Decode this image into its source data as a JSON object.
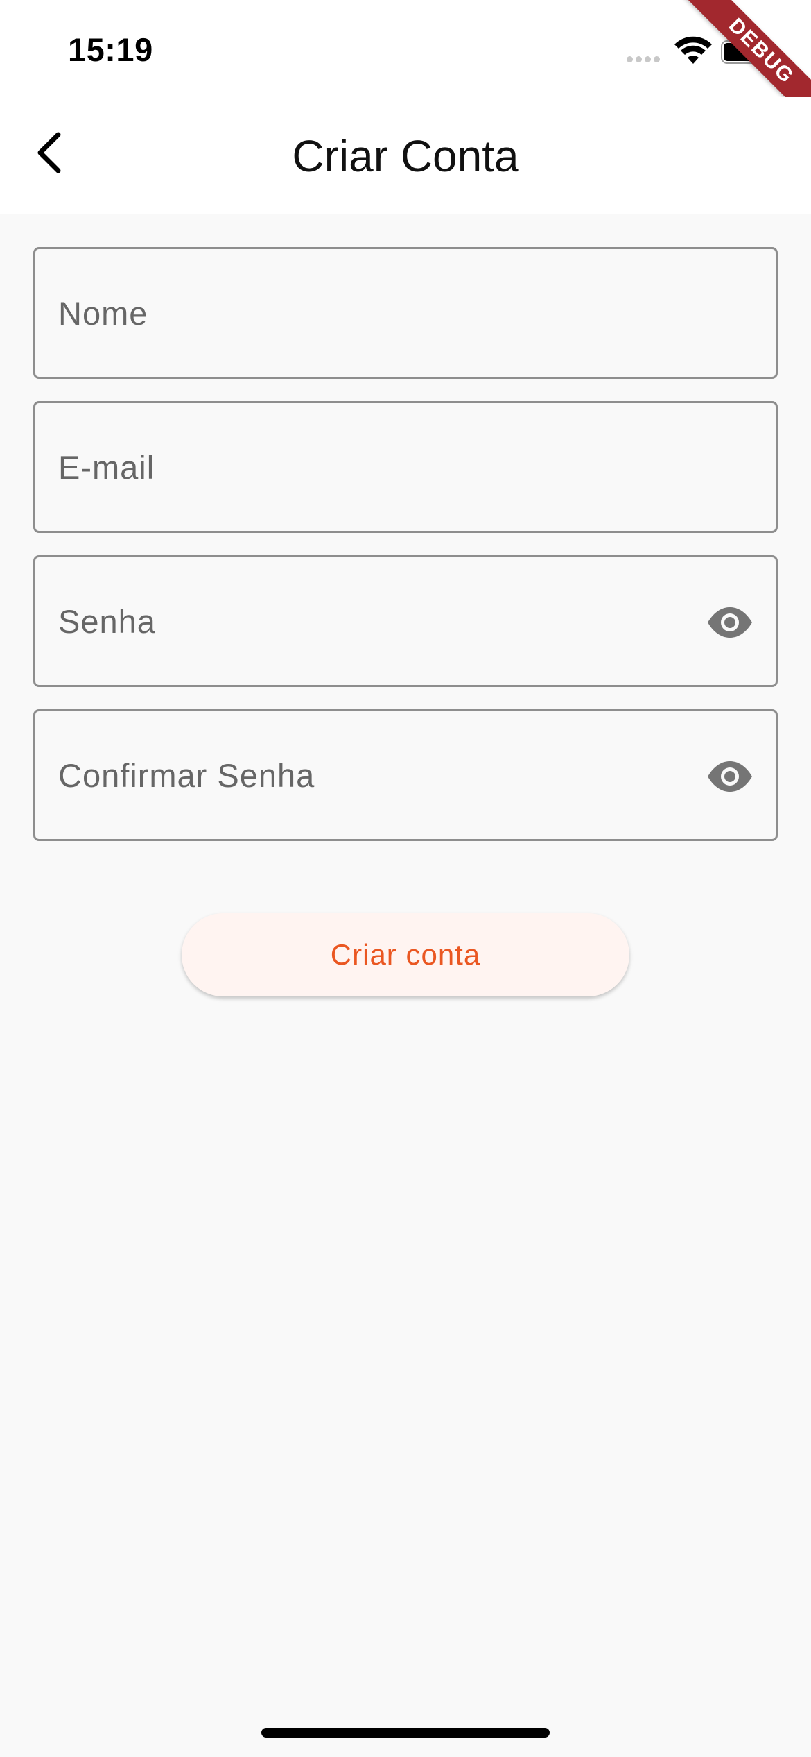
{
  "status_bar": {
    "time": "15:19",
    "signal_icon": "cellular-signal-dots",
    "wifi_icon": "wifi-icon",
    "battery_icon": "battery-full-icon",
    "debug_banner": "DEBUG",
    "debug_color": "#a2282e"
  },
  "app_bar": {
    "title": "Criar Conta",
    "back_icon": "chevron-left-icon"
  },
  "form": {
    "name": {
      "placeholder": "Nome",
      "value": ""
    },
    "email": {
      "placeholder": "E-mail",
      "value": ""
    },
    "password": {
      "placeholder": "Senha",
      "value": "",
      "toggle_icon": "eye-icon"
    },
    "confirm_password": {
      "placeholder": "Confirmar Senha",
      "value": "",
      "toggle_icon": "eye-icon"
    }
  },
  "submit": {
    "label": "Criar conta",
    "text_color": "#ea5722",
    "background": "#fff4f1"
  }
}
